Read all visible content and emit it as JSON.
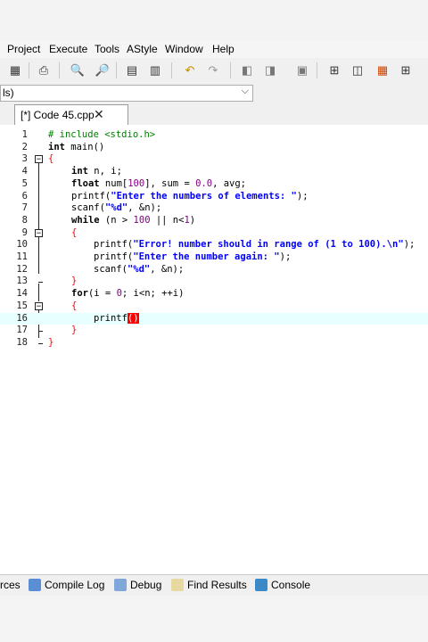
{
  "menu": [
    "Project",
    "Execute",
    "Tools",
    "AStyle",
    "Window",
    "Help"
  ],
  "combo": {
    "value": "ls)"
  },
  "tab": {
    "label": "[*] Code 45.cpp",
    "close": "✕"
  },
  "editor": {
    "lines": [
      {
        "n": "1"
      },
      {
        "n": "2"
      },
      {
        "n": "3"
      },
      {
        "n": "4"
      },
      {
        "n": "5"
      },
      {
        "n": "6"
      },
      {
        "n": "7"
      },
      {
        "n": "8"
      },
      {
        "n": "9"
      },
      {
        "n": "10"
      },
      {
        "n": "11"
      },
      {
        "n": "12"
      },
      {
        "n": "13"
      },
      {
        "n": "14"
      },
      {
        "n": "15"
      },
      {
        "n": "16"
      },
      {
        "n": "17"
      },
      {
        "n": "18"
      }
    ],
    "code": {
      "l1": "# include <stdio.h>",
      "l2a": "int",
      "l2b": " main()",
      "l3": "{",
      "l4a": "int",
      "l4b": " n, i;",
      "l5a": "float",
      "l5b": " num[",
      "l5c": "100",
      "l5d": "], sum = ",
      "l5e": "0.0",
      "l5f": ", avg;",
      "l6a": "printf(",
      "l6b": "\"Enter the numbers of elements: \"",
      "l6c": ");",
      "l7a": "scanf(",
      "l7b": "\"%d\"",
      "l7c": ", &n);",
      "l8a": "while",
      "l8b": " (n > ",
      "l8c": "100",
      "l8d": " || n<",
      "l8e": "1",
      "l8f": ")",
      "l9": "{",
      "l10a": "printf(",
      "l10b": "\"Error! number should in range of (1 to 100).\\n\"",
      "l10c": ");",
      "l11a": "printf(",
      "l11b": "\"Enter the number again: \"",
      "l11c": ");",
      "l12a": "scanf(",
      "l12b": "\"%d\"",
      "l12c": ", &n);",
      "l13": "}",
      "l14a": "for",
      "l14b": "(i = ",
      "l14c": "0",
      "l14d": "; i<n; ++i)",
      "l15": "{",
      "l16a": "printf",
      "l16b": "()",
      "l17": "}",
      "l18": "}"
    }
  },
  "bottom_tabs": {
    "resources": "rces",
    "compile_log": "Compile Log",
    "debug": "Debug",
    "find_results": "Find Results",
    "console": "Console"
  }
}
